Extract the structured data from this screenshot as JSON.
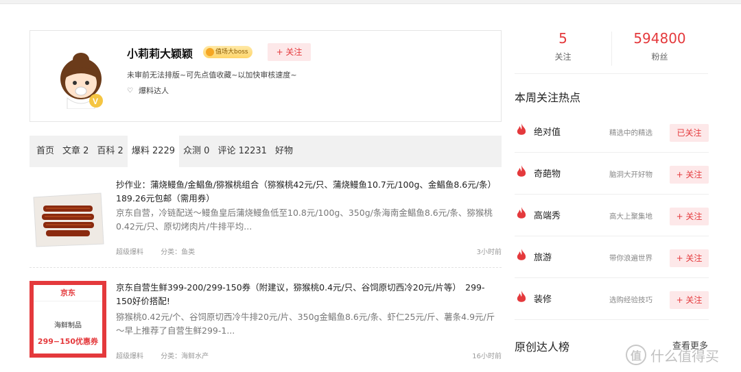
{
  "profile": {
    "username": "小莉莉大颖颖",
    "badge": "值场大boss",
    "follow_label": "+ 关注",
    "bio": "未审前无法排版~可先点值收藏~以加快审核速度~",
    "tag": "爆料达人"
  },
  "tabs": [
    {
      "label": "首页"
    },
    {
      "label": "文章 2"
    },
    {
      "label": "百科 2"
    },
    {
      "label": "爆料 2229"
    },
    {
      "label": "众测 0"
    },
    {
      "label": "评论 12231"
    },
    {
      "label": "好物"
    }
  ],
  "feed": [
    {
      "title": "抄作业：蒲烧鳗鱼/金鲳鱼/猕猴桃组合（猕猴桃42元/只、蒲烧鳗鱼10.7元/100g、金鲳鱼8.6元/条）　189.26元包邮（需用券）",
      "desc": "京东自营，冷链配送～鳗鱼皇后蒲烧鳗鱼低至10.8元/100g、350g/条海南金鲳鱼8.6元/条、猕猴桃0.42元/只、原切烤肉片/牛排平均...",
      "source": "超级爆料",
      "category": "分类：鱼类",
      "time": "3小时前"
    },
    {
      "title": "京东自营生鲜399-200/299-150券（附建议，猕猴桃0.4元/只、谷饲原切西冷20元/片等）　299-150好价搭配!",
      "desc": "猕猴桃0.42元/个、谷饲原切西冷牛排20元/片、350g金鲳鱼8.6元/条、虾仁25元/斤、薯条4.9元/斤～早上推荐了自营生鲜299-1...",
      "source": "超级爆料",
      "category": "分类：海鲜水产",
      "time": "16小时前",
      "img_brand": "京东",
      "img_label": "海鲜制品",
      "img_coupon": "299−150优惠券"
    }
  ],
  "stats": {
    "following_num": "5",
    "following_label": "关注",
    "fans_num": "594800",
    "fans_label": "粉丝"
  },
  "hot_title": "本周关注热点",
  "hot": [
    {
      "name": "绝对值",
      "desc": "精选中的精选",
      "btn": "已关注"
    },
    {
      "name": "奇葩物",
      "desc": "脑洞大开好物",
      "btn": "+ 关注"
    },
    {
      "name": "高端秀",
      "desc": "高大上聚集地",
      "btn": "+ 关注"
    },
    {
      "name": "旅游",
      "desc": "带你浪遍世界",
      "btn": "+ 关注"
    },
    {
      "name": "装修",
      "desc": "选购经验技巧",
      "btn": "+ 关注"
    }
  ],
  "ranking_title": "原创达人榜",
  "see_more": "查看更多",
  "watermark": "什么值得买",
  "colors": {
    "accent": "#e4393c",
    "accent_bg": "#fde8e9"
  }
}
